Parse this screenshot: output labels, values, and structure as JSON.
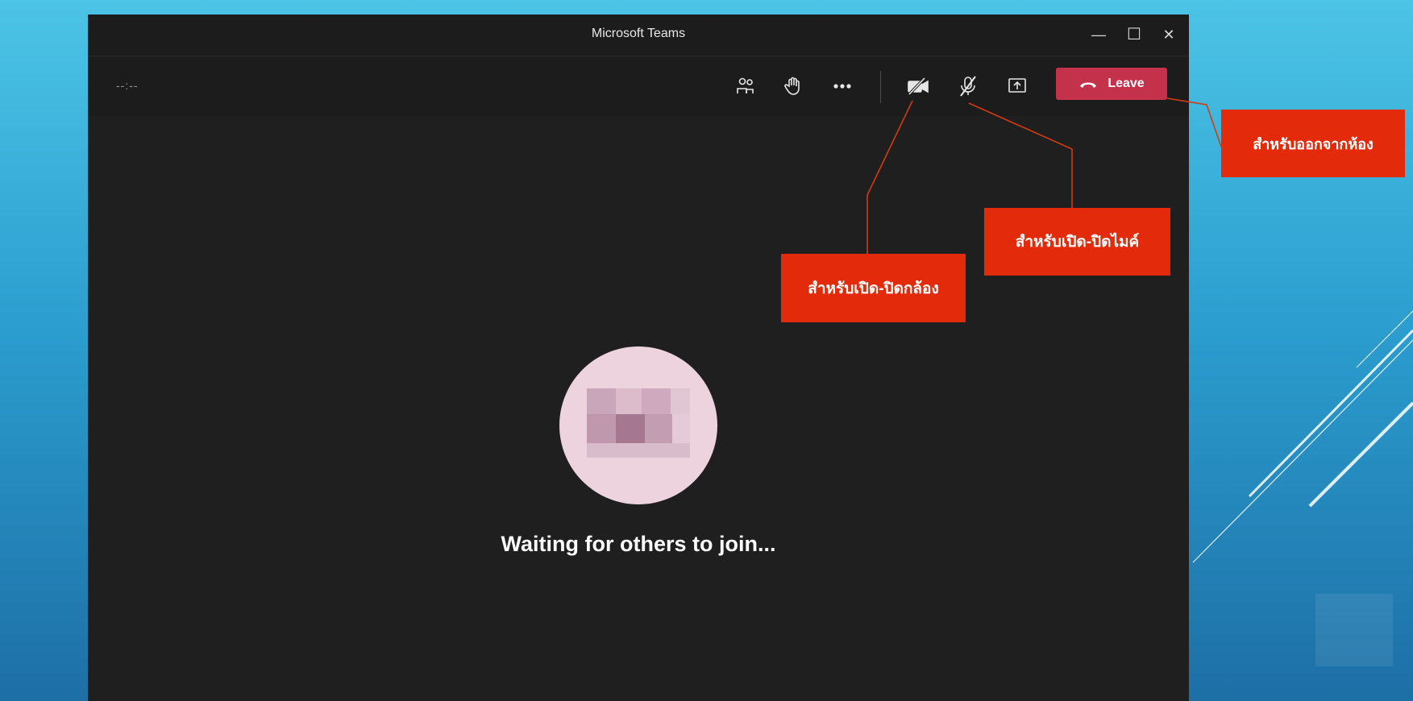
{
  "window": {
    "title": "Microsoft Teams",
    "timer": "--:--",
    "controls": {
      "minimize": "—",
      "maximize": "☐",
      "close": "✕"
    }
  },
  "toolbar": {
    "icons": [
      "participants-icon",
      "raise-hand-icon",
      "more-icon",
      "camera-off-icon",
      "mic-off-icon",
      "share-screen-icon",
      "phone-hangup-icon"
    ],
    "leave_label": "Leave",
    "leave_color": "#c4314b"
  },
  "stage": {
    "status_text": "Waiting for others to join..."
  },
  "callouts": {
    "camera": "สำหรับเปิด-ปิดกล้อง",
    "mic": "สำหรับเปิด-ปิดไมค์",
    "leave": "สำหรับออกจากห้อง",
    "color": "#e32b0b"
  }
}
